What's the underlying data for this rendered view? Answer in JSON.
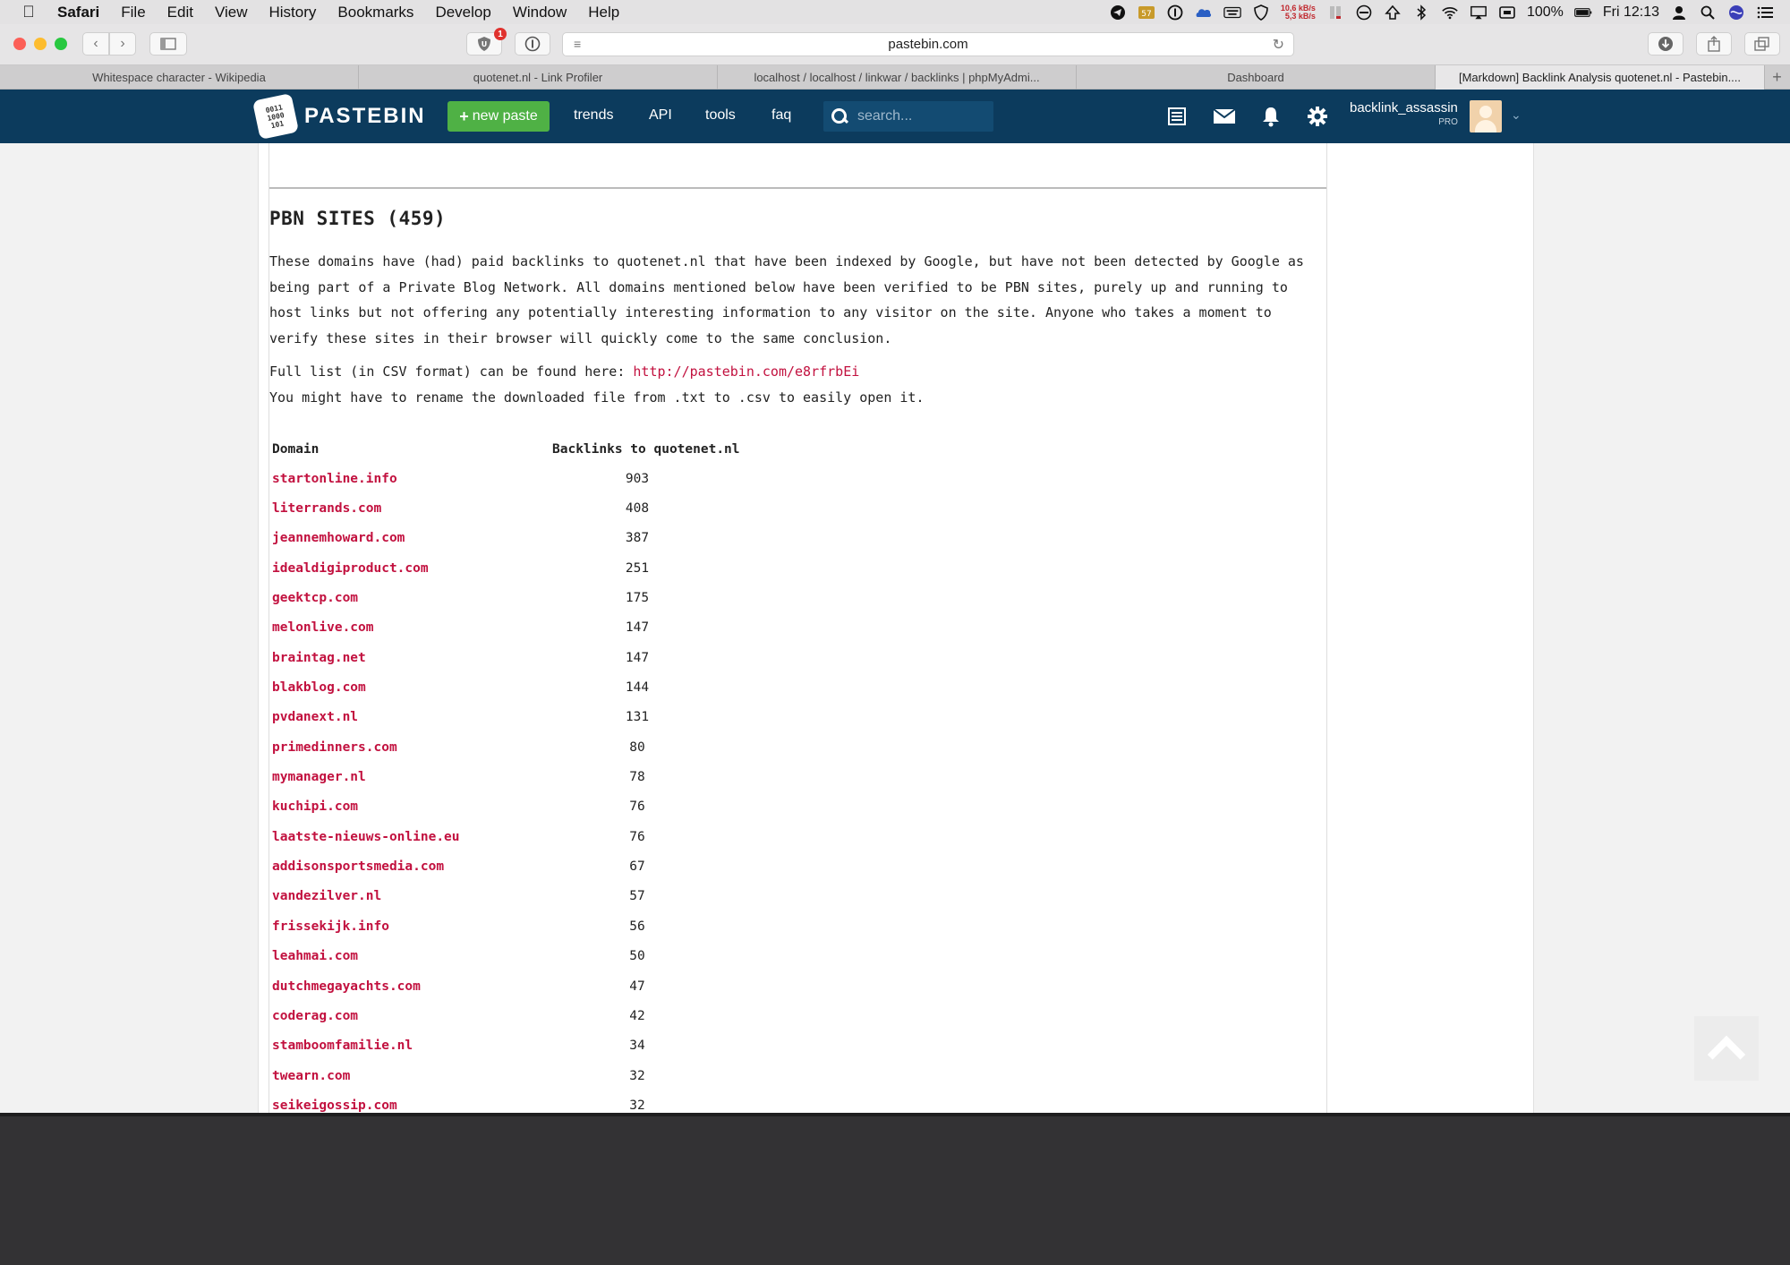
{
  "menubar": {
    "app": "Safari",
    "items": [
      "File",
      "Edit",
      "View",
      "History",
      "Bookmarks",
      "Develop",
      "Window",
      "Help"
    ],
    "network_up": "10,6 kB/s",
    "network_down": "5,3 kB/s",
    "battery": "100%",
    "clock": "Fri 12:13"
  },
  "toolbar": {
    "address": "pastebin.com",
    "extension_badge": "1"
  },
  "tabs": [
    {
      "label": "Whitespace character - Wikipedia"
    },
    {
      "label": "quotenet.nl - Link Profiler"
    },
    {
      "label": "localhost / localhost / linkwar / backlinks | phpMyAdmi..."
    },
    {
      "label": "Dashboard"
    },
    {
      "label": "[Markdown] Backlink Analysis quotenet.nl - Pastebin...."
    }
  ],
  "pastebin": {
    "logo_text": "PASTEBIN",
    "logo_mark": "0011\n1000\n101",
    "new_paste": "new paste",
    "nav": [
      "trends",
      "API",
      "tools",
      "faq"
    ],
    "search_placeholder": "search...",
    "username": "backlink_assassin",
    "user_tier": "PRO"
  },
  "paste": {
    "heading": "PBN SITES (459)",
    "paragraph": "These domains have (had) paid backlinks to quotenet.nl that have been indexed by Google, but have not been detected by Google as being part of a Private Blog Network. All domains mentioned below have been verified to be PBN sites, purely up and running to host links but not offering any potentially interesting information to any visitor on the site. Anyone who takes a moment to verify these sites in their browser will quickly come to the same conclusion.",
    "csv_prefix": "Full list (in CSV format) can be found here: ",
    "csv_link": "http://pastebin.com/e8rfrbEi",
    "rename_note": "You might have to rename the downloaded file from .txt to .csv to easily open it.",
    "table": {
      "headers": [
        "Domain",
        "Backlinks to quotenet.nl"
      ],
      "rows": [
        [
          "startonline.info",
          "903"
        ],
        [
          "literrands.com",
          "408"
        ],
        [
          "jeannemhoward.com",
          "387"
        ],
        [
          "idealdigiproduct.com",
          "251"
        ],
        [
          "geektcp.com",
          "175"
        ],
        [
          "melonlive.com",
          "147"
        ],
        [
          "braintag.net",
          "147"
        ],
        [
          "blakblog.com",
          "144"
        ],
        [
          "pvdanext.nl",
          "131"
        ],
        [
          "primedinners.com",
          "80"
        ],
        [
          "mymanager.nl",
          "78"
        ],
        [
          "kuchipi.com",
          "76"
        ],
        [
          "laatste-nieuws-online.eu",
          "76"
        ],
        [
          "addisonsportsmedia.com",
          "67"
        ],
        [
          "vandezilver.nl",
          "57"
        ],
        [
          "frissekijk.info",
          "56"
        ],
        [
          "leahmai.com",
          "50"
        ],
        [
          "dutchmegayachts.com",
          "47"
        ],
        [
          "coderag.com",
          "42"
        ],
        [
          "stamboomfamilie.nl",
          "34"
        ],
        [
          "twearn.com",
          "32"
        ],
        [
          "seikeigossip.com",
          "32"
        ]
      ]
    }
  }
}
